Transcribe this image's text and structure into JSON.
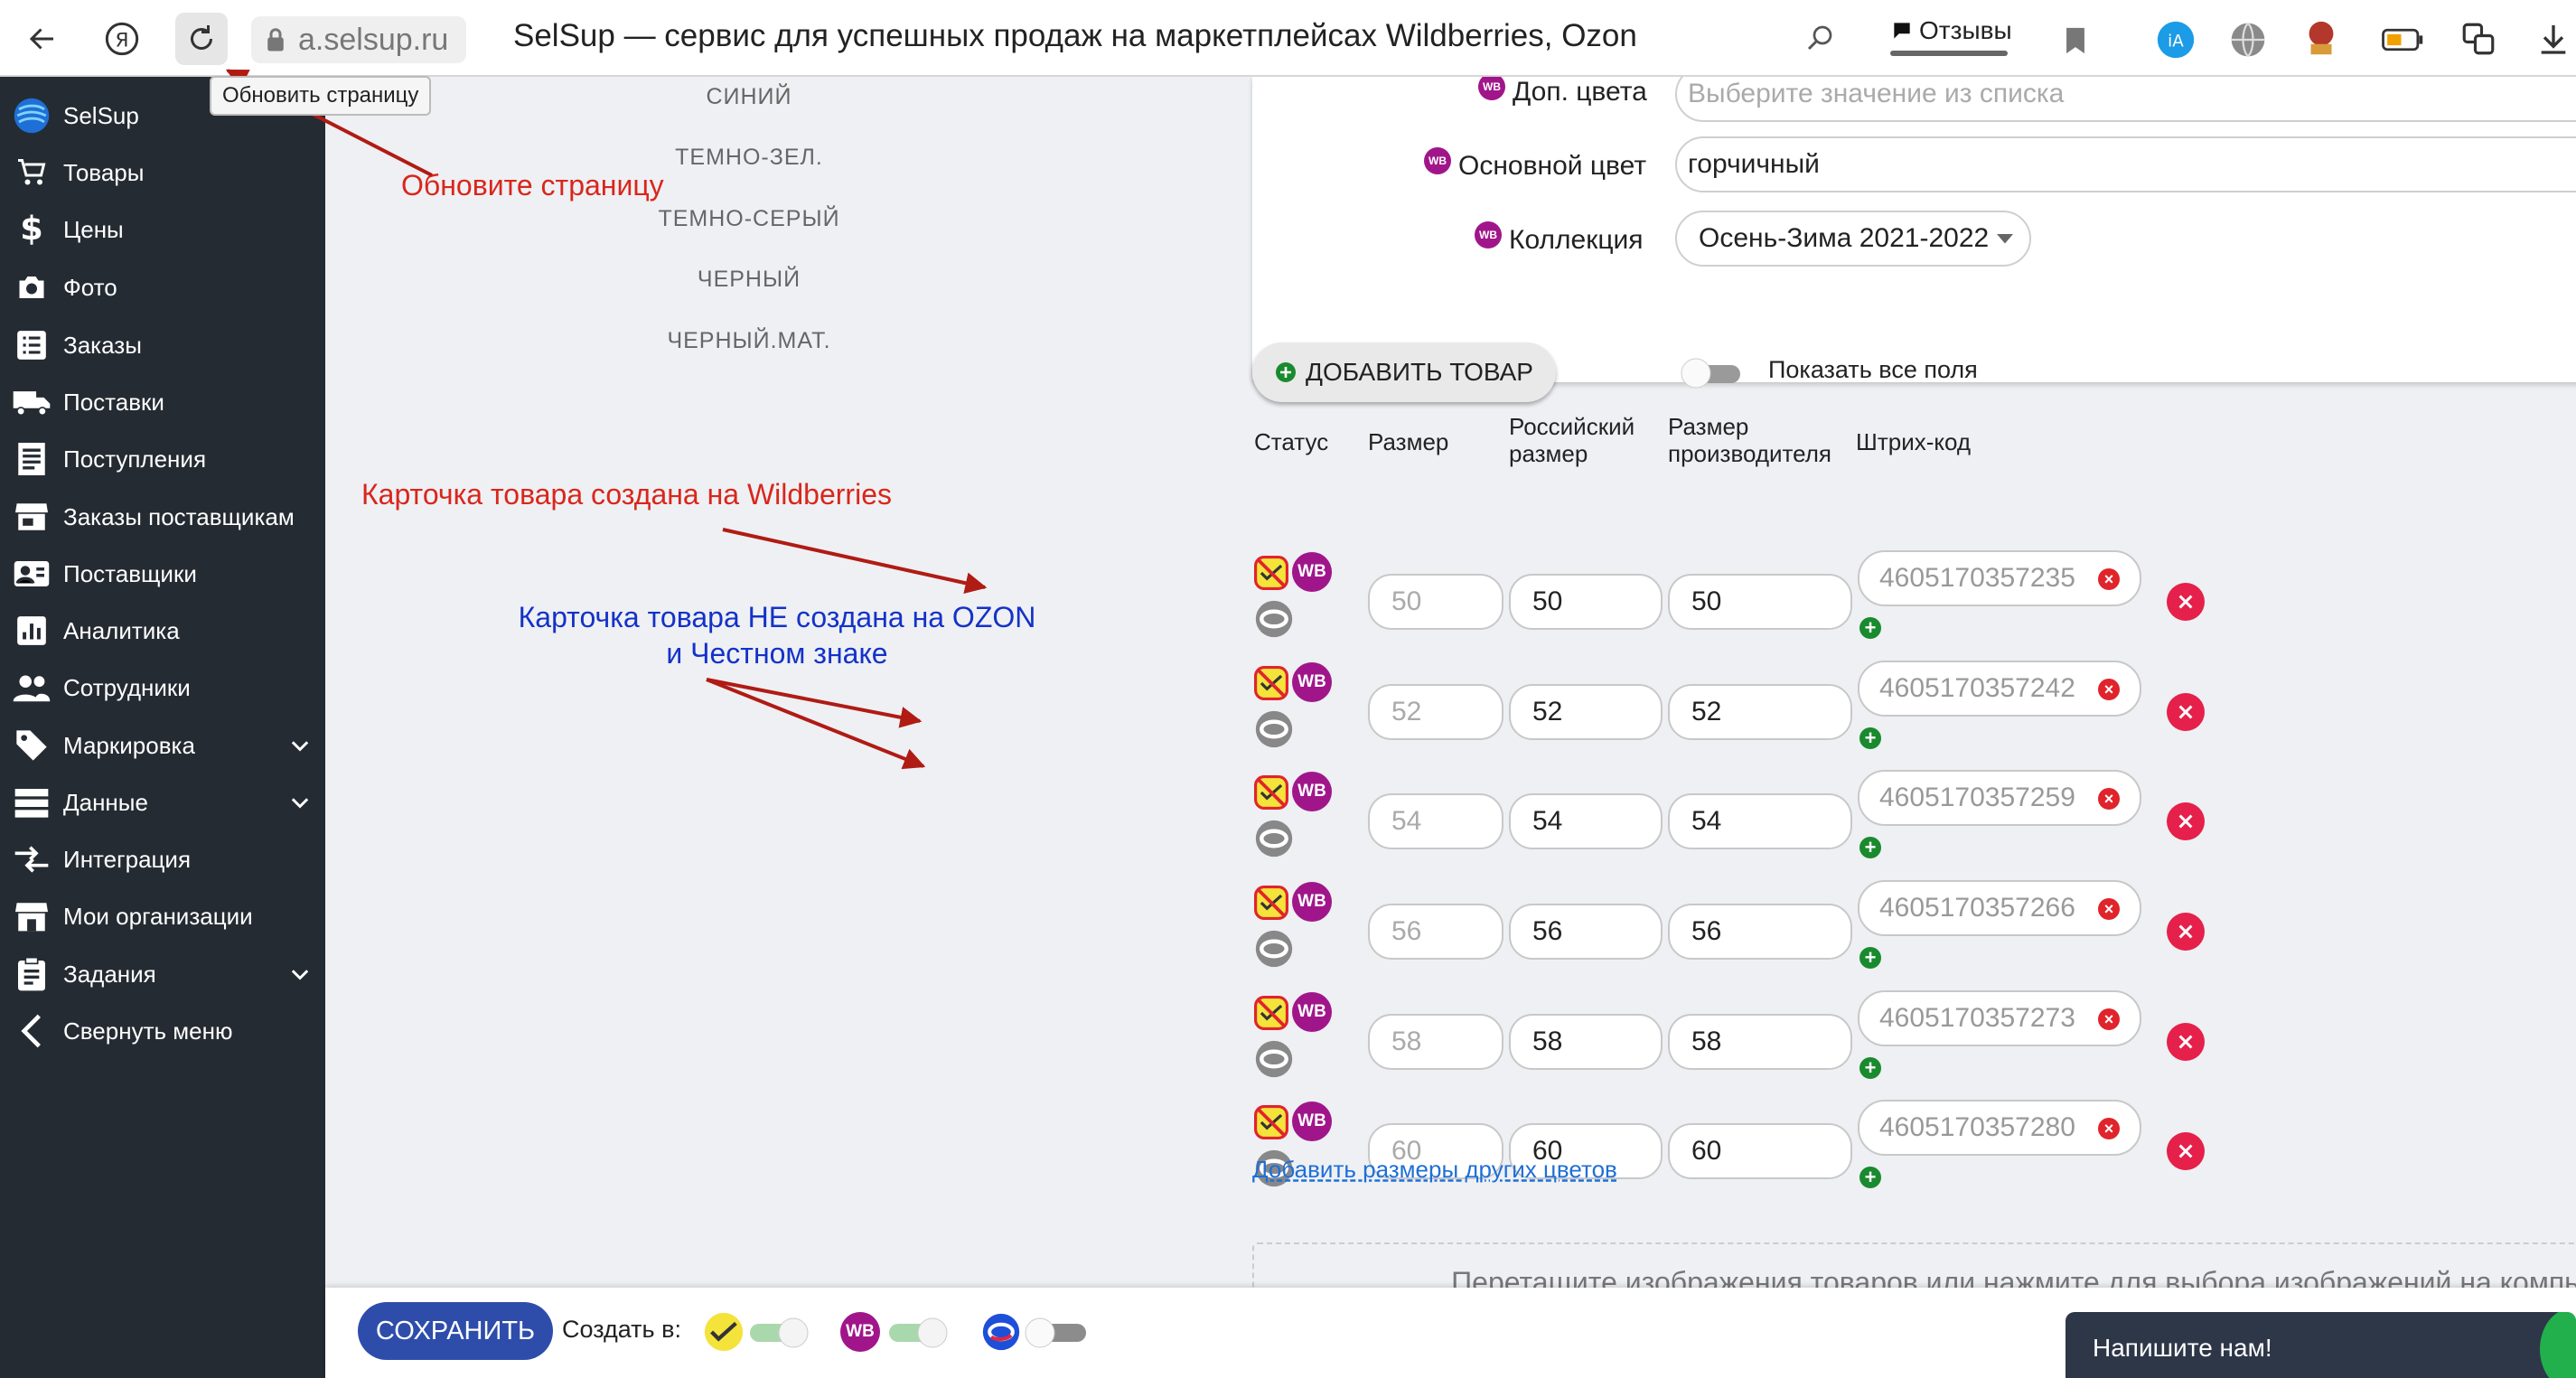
{
  "browser": {
    "address": "a.selsup.ru",
    "page_title": "SelSup — сервис для успешных продаж на маркетплейсах Wildberries, Ozon",
    "reviews_label": "Отзывы",
    "tooltip": "Обновить страницу"
  },
  "sidebar": {
    "brand": "SelSup",
    "items": [
      {
        "label": "Товары",
        "icon": "cart-icon"
      },
      {
        "label": "Цены",
        "icon": "dollar-icon"
      },
      {
        "label": "Фото",
        "icon": "camera-icon"
      },
      {
        "label": "Заказы",
        "icon": "list-icon"
      },
      {
        "label": "Поставки",
        "icon": "truck-icon"
      },
      {
        "label": "Поступления",
        "icon": "receipt-icon"
      },
      {
        "label": "Заказы поставщикам",
        "icon": "store-icon"
      },
      {
        "label": "Поставщики",
        "icon": "contact-card-icon"
      },
      {
        "label": "Аналитика",
        "icon": "chart-icon"
      },
      {
        "label": "Сотрудники",
        "icon": "people-icon"
      },
      {
        "label": "Маркировка",
        "icon": "tag-icon",
        "expandable": true
      },
      {
        "label": "Данные",
        "icon": "storage-icon",
        "expandable": true
      },
      {
        "label": "Интеграция",
        "icon": "arrows-icon"
      },
      {
        "label": "Мои организации",
        "icon": "building-icon"
      },
      {
        "label": "Задания",
        "icon": "clipboard-icon",
        "expandable": true
      },
      {
        "label": "Свернуть меню",
        "icon": "chevron-left-icon"
      }
    ]
  },
  "color_options": [
    "СИНИЙ",
    "ТЕМНО-ЗЕЛ.",
    "ТЕМНО-СЕРЫЙ",
    "ЧЕРНЫЙ",
    "ЧЕРНЫЙ.МАТ."
  ],
  "form": {
    "wb_badge": "WB",
    "extra_colors_label": "Доп. цвета",
    "extra_colors_placeholder": "Выберите значение из списка",
    "main_color_label": "Основной цвет",
    "main_color_value": "горчичный",
    "collection_label": "Коллекция",
    "collection_value": "Осень-Зима 2021-2022"
  },
  "controls": {
    "add_product": "ДОБАВИТЬ ТОВАР",
    "show_all_fields": "Показать все поля"
  },
  "table": {
    "headers": {
      "status": "Статус",
      "size": "Размер",
      "ru_size": "Российский размер",
      "maker_size": "Размер производителя",
      "barcode": "Штрих-код"
    },
    "rows": [
      {
        "size": "50",
        "ru_size": "50",
        "maker_size": "50",
        "barcode": "4605170357235"
      },
      {
        "size": "52",
        "ru_size": "52",
        "maker_size": "52",
        "barcode": "4605170357242"
      },
      {
        "size": "54",
        "ru_size": "54",
        "maker_size": "54",
        "barcode": "4605170357259"
      },
      {
        "size": "56",
        "ru_size": "56",
        "maker_size": "56",
        "barcode": "4605170357266"
      },
      {
        "size": "58",
        "ru_size": "58",
        "maker_size": "58",
        "barcode": "4605170357273"
      },
      {
        "size": "60",
        "ru_size": "60",
        "maker_size": "60",
        "barcode": "4605170357280"
      }
    ]
  },
  "add_other_sizes": "Добавить размеры других цветов",
  "dropzone_text": "Перетащите изображения товаров или нажмите для выбора изображений на компьютере",
  "annotations": {
    "refresh": "Обновите страницу",
    "wb_created": "Карточка товара создана на Wildberries",
    "not_created_line1": "Карточка товара НЕ создана на OZON",
    "not_created_line2": "и Честном знаке",
    "color_red": "#d9261c",
    "color_blue": "#1432c8"
  },
  "bottom": {
    "save": "СОХРАНИТЬ",
    "create_in": "Создать в:",
    "chat": "Напишите нам!"
  },
  "colors": {
    "sidebar_bg": "#252b32",
    "wb_purple": "#a0168a",
    "save_blue": "#2e4dab",
    "delete_pink": "#e5204a"
  }
}
